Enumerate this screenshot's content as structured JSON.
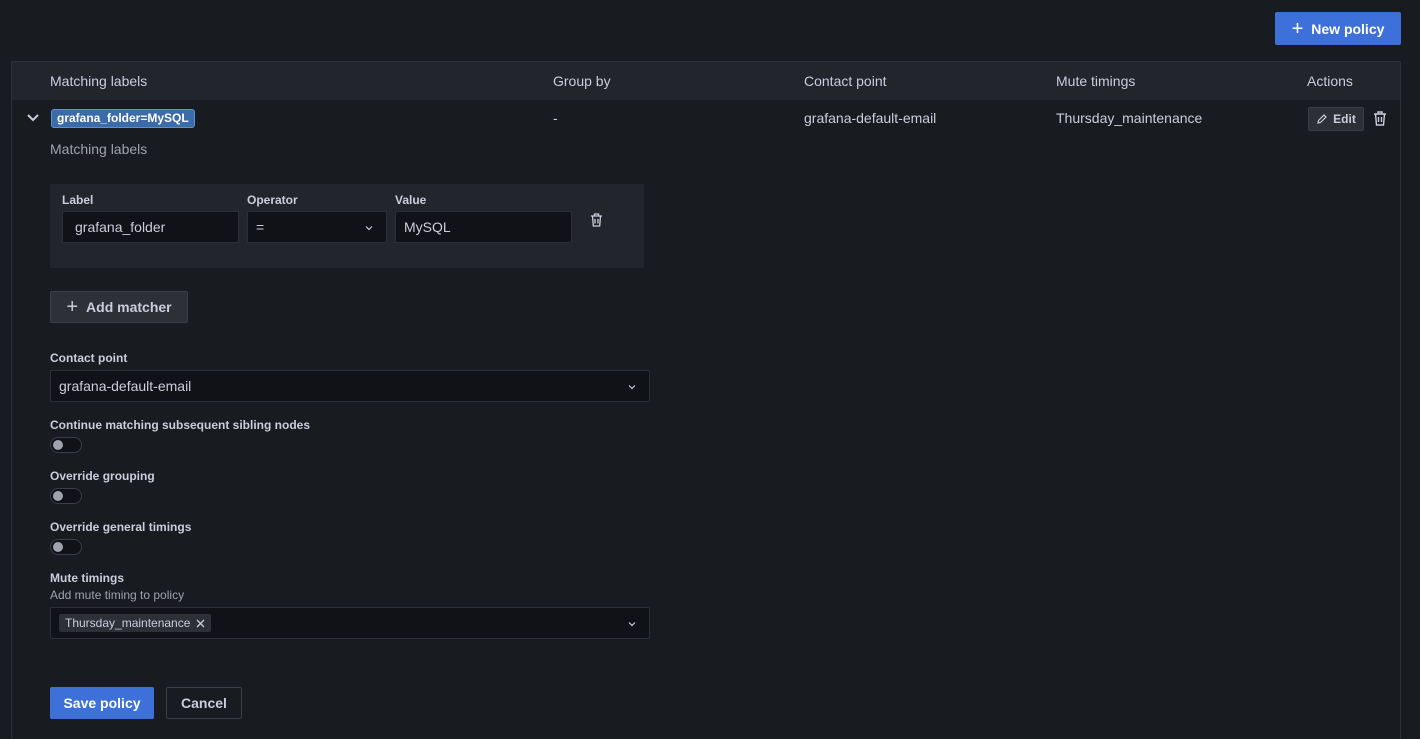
{
  "toolbar": {
    "new_policy_label": "New policy"
  },
  "table": {
    "headers": [
      "Matching labels",
      "Group by",
      "Contact point",
      "Mute timings",
      "Actions"
    ],
    "row": {
      "label_badge": "grafana_folder=MySQL",
      "group_by": "-",
      "contact_point": "grafana-default-email",
      "mute_timings": "Thursday_maintenance",
      "edit_label": "Edit"
    }
  },
  "form": {
    "matching_labels_heading": "Matching labels",
    "matcher": {
      "label_header": "Label",
      "operator_header": "Operator",
      "value_header": "Value",
      "label_value": "grafana_folder",
      "operator_value": "=",
      "value_value": "MySQL"
    },
    "add_matcher_label": "Add matcher",
    "contact_point_label": "Contact point",
    "contact_point_value": "grafana-default-email",
    "continue_matching_label": "Continue matching subsequent sibling nodes",
    "override_grouping_label": "Override grouping",
    "override_timings_label": "Override general timings",
    "mute_timings_label": "Mute timings",
    "mute_timings_description": "Add mute timing to policy",
    "mute_timings_selected": "Thursday_maintenance",
    "save_label": "Save policy",
    "cancel_label": "Cancel"
  },
  "colors": {
    "primary": "#3d71d9",
    "background": "#181b1f",
    "panel": "#22252b"
  }
}
